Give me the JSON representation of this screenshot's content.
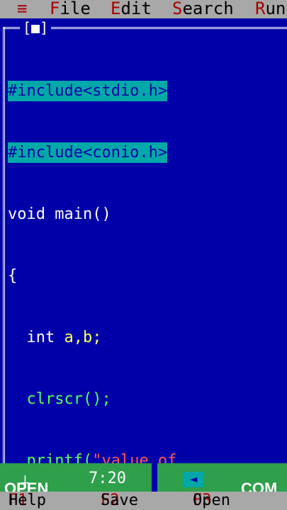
{
  "menu": {
    "system_icon": "≡",
    "items": [
      {
        "hot": "F",
        "rest": "ile"
      },
      {
        "hot": "E",
        "rest": "dit"
      },
      {
        "hot": "S",
        "rest": "earch"
      },
      {
        "hot": "R",
        "rest": "un"
      }
    ]
  },
  "editor": {
    "close_box": "[■]",
    "lines": [
      {
        "text": "#include<stdio.h>",
        "selected": true
      },
      {
        "text": "#include<conio.h>",
        "selected": true
      },
      {
        "text": "void main()"
      },
      {
        "text": "{"
      },
      {
        "kw": "  int ",
        "rest": "a,b;"
      },
      {
        "kw": "  clrscr",
        "rest": "();"
      },
      {
        "kw": "  printf(",
        "str": "\"value of"
      }
    ]
  },
  "status": {
    "cursor": "7:20",
    "open_button": "OPEN",
    "compile_button": "COM"
  },
  "function_keys": [
    {
      "key": "F1",
      "label": " Help"
    },
    {
      "key": "F2",
      "label": " Save"
    },
    {
      "key": "F3",
      "label": " Open"
    }
  ],
  "colors": {
    "editor_bg": "#0000a8",
    "menu_bg": "#a8a8a8",
    "selection": "#00a8a8",
    "status_bg": "#2e9f4a"
  }
}
